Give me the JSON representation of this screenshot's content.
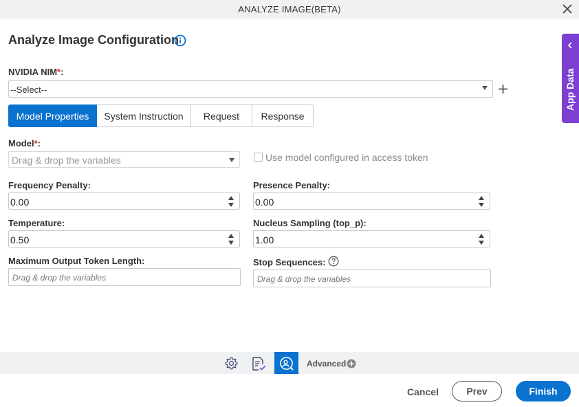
{
  "window": {
    "title": "ANALYZE IMAGE(BETA)",
    "close_icon": "close-icon"
  },
  "page": {
    "heading": "Analyze Image Configuration",
    "info_icon": "info-icon"
  },
  "nim": {
    "label": "NVIDIA NIM",
    "required_mark": "*",
    "colon": ":",
    "selected": "--Select--",
    "add_icon": "plus-icon"
  },
  "tabs": [
    {
      "label": "Model Properties",
      "active": true
    },
    {
      "label": "System Instruction",
      "active": false
    },
    {
      "label": "Request",
      "active": false
    },
    {
      "label": "Response",
      "active": false
    }
  ],
  "model": {
    "label": "Model",
    "required_mark": "*",
    "colon": ":",
    "placeholder": "Drag & drop the variables",
    "use_token_label": "Use model configured in access token",
    "use_token_checked": false
  },
  "frequency_penalty": {
    "label": "Frequency Penalty:",
    "value": "0.00"
  },
  "presence_penalty": {
    "label": "Presence Penalty:",
    "value": "0.00"
  },
  "temperature": {
    "label": "Temperature:",
    "value": "0.50"
  },
  "nucleus_sampling": {
    "label": "Nucleus Sampling (top_p):",
    "value": "1.00"
  },
  "max_output_tokens": {
    "label": "Maximum Output Token Length:",
    "placeholder": "Drag & drop the variables"
  },
  "stop_sequences": {
    "label": "Stop Sequences:",
    "placeholder": "Drag & drop the variables",
    "help_icon": "help-icon"
  },
  "side_panel": {
    "label": "App Data",
    "icon": "chevron-left-icon"
  },
  "toolbar": {
    "icons": [
      "gear-icon",
      "form-check-icon",
      "image-analyze-icon"
    ],
    "active_icon": "image-analyze-icon",
    "advanced_label": "Advanced",
    "advanced_icon": "plus-circle-icon"
  },
  "footer": {
    "cancel_label": "Cancel",
    "prev_label": "Prev",
    "finish_label": "Finish"
  },
  "colors": {
    "primary": "#0a72cf",
    "side_tab": "#7b3fd1",
    "required": "#d32f2f",
    "toolbar_bg": "#f0f1f3"
  }
}
